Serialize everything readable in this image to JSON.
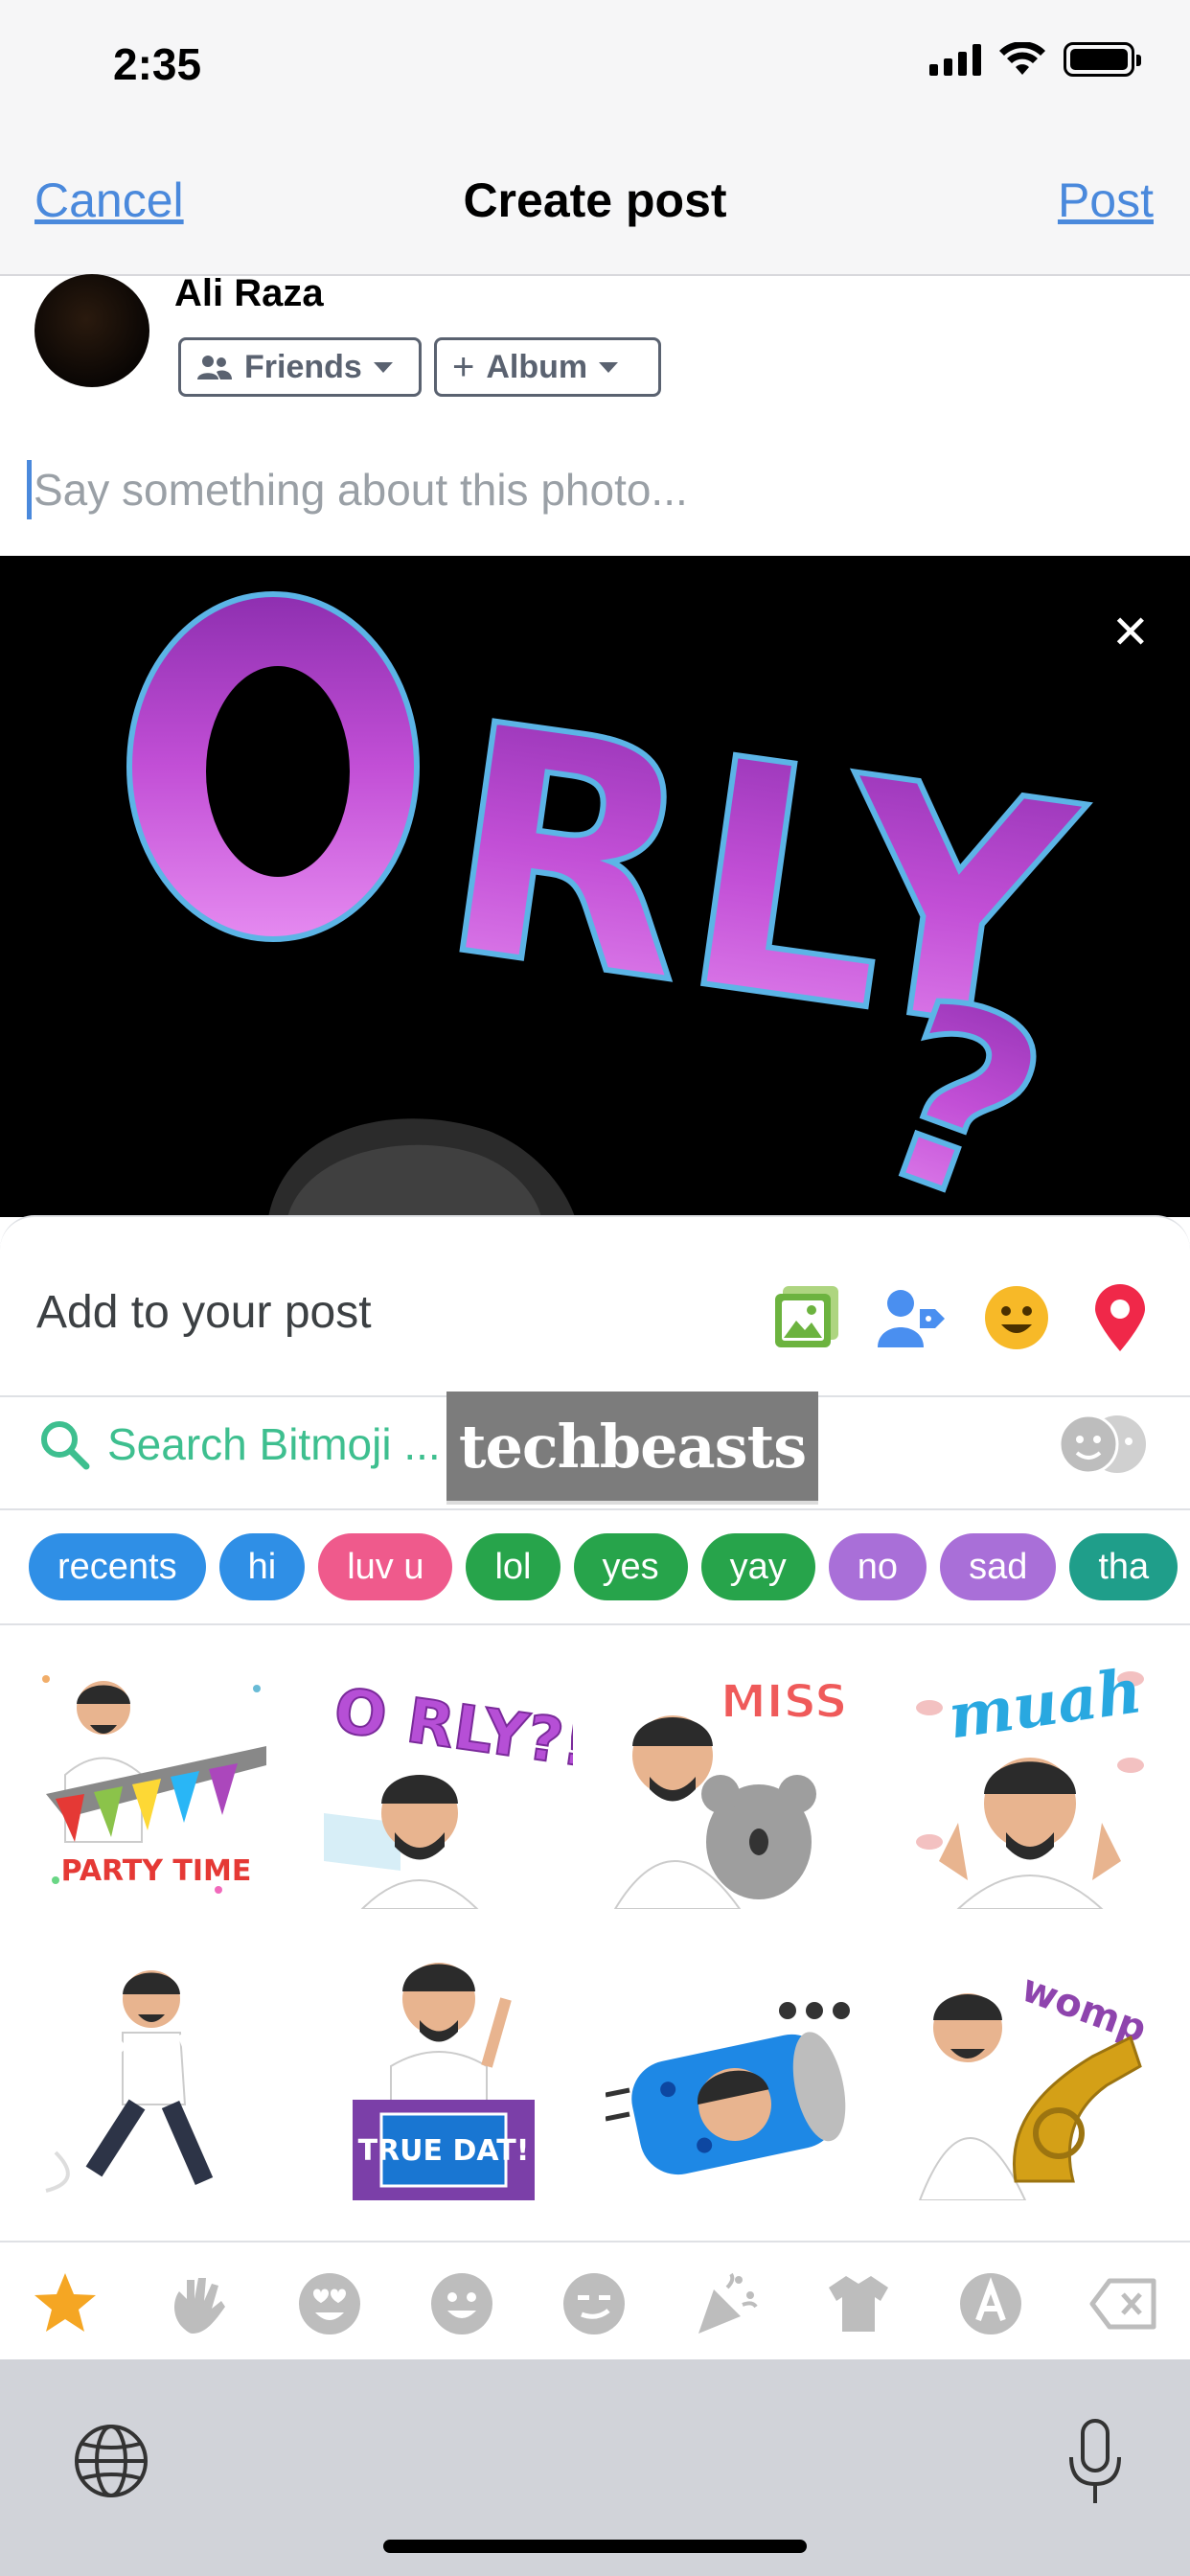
{
  "status_bar": {
    "time": "2:35"
  },
  "header": {
    "cancel": "Cancel",
    "title": "Create post",
    "post": "Post"
  },
  "author": {
    "name": "Ali Raza",
    "audience": "Friends",
    "album": "Album"
  },
  "composer": {
    "placeholder": "Say something about this photo..."
  },
  "photo": {
    "text": "O RLY?",
    "close": "✕"
  },
  "add_to_post": {
    "label": "Add to your post",
    "icons": [
      "photo-icon",
      "tag-people-icon",
      "feeling-icon",
      "location-icon"
    ]
  },
  "bitmoji": {
    "search_placeholder": "Search Bitmoji ...",
    "watermark": "techbeasts",
    "categories": [
      {
        "label": "recents",
        "color": "#2f8fe6"
      },
      {
        "label": "hi",
        "color": "#2f8fe6"
      },
      {
        "label": "luv u",
        "color": "#ef5a8c"
      },
      {
        "label": "lol",
        "color": "#27a44b"
      },
      {
        "label": "yes",
        "color": "#27a44b"
      },
      {
        "label": "yay",
        "color": "#27a44b"
      },
      {
        "label": "no",
        "color": "#a96fd8"
      },
      {
        "label": "sad",
        "color": "#a96fd8"
      },
      {
        "label": "tha",
        "color": "#1f9e8a"
      }
    ],
    "stickers": [
      {
        "name": "party-time",
        "text": "PARTY TIME"
      },
      {
        "name": "o-rly",
        "text": "O RLY?!"
      },
      {
        "name": "miss-you",
        "text": "MISS YOU"
      },
      {
        "name": "muah",
        "text": "muah"
      },
      {
        "name": "dance",
        "text": ""
      },
      {
        "name": "true-dat",
        "text": "TRUE DAT!"
      },
      {
        "name": "soda-can",
        "text": ""
      },
      {
        "name": "womp-womp",
        "text": "womp womp"
      }
    ]
  },
  "colors": {
    "link": "#4a89dc",
    "bitmoji_green": "#3ebf8f",
    "star": "#f5a623",
    "keyboard_bg": "#d1d3d9"
  },
  "category_bar": [
    "star-icon",
    "wave-icon",
    "heart-eyes-icon",
    "smile-icon",
    "smirk-icon",
    "party-icon",
    "shirt-icon",
    "text-icon",
    "delete-icon"
  ]
}
